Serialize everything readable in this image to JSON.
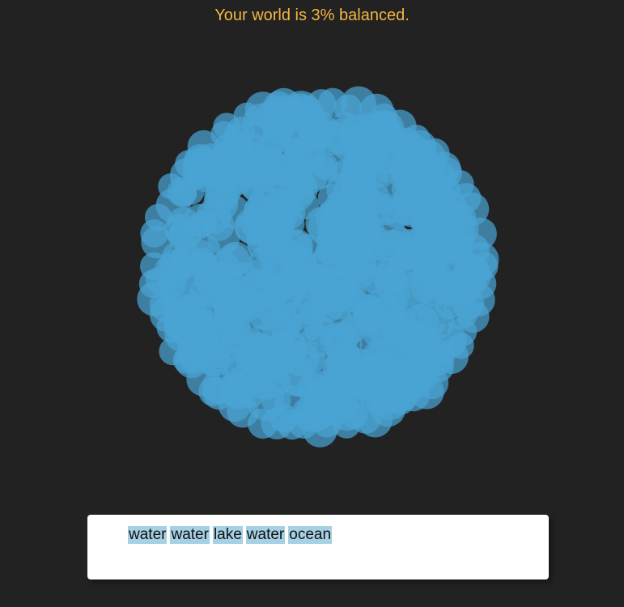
{
  "header": {
    "status_text": "Your world is 3% balanced.",
    "status_color": "#f2b640"
  },
  "world": {
    "balance_percent": 3,
    "blob_color": "#4aa3d3",
    "background_color": "#222222"
  },
  "input": {
    "words": [
      "water",
      "water",
      "lake",
      "water",
      "ocean"
    ],
    "highlight_color": "#a6d0e3"
  }
}
